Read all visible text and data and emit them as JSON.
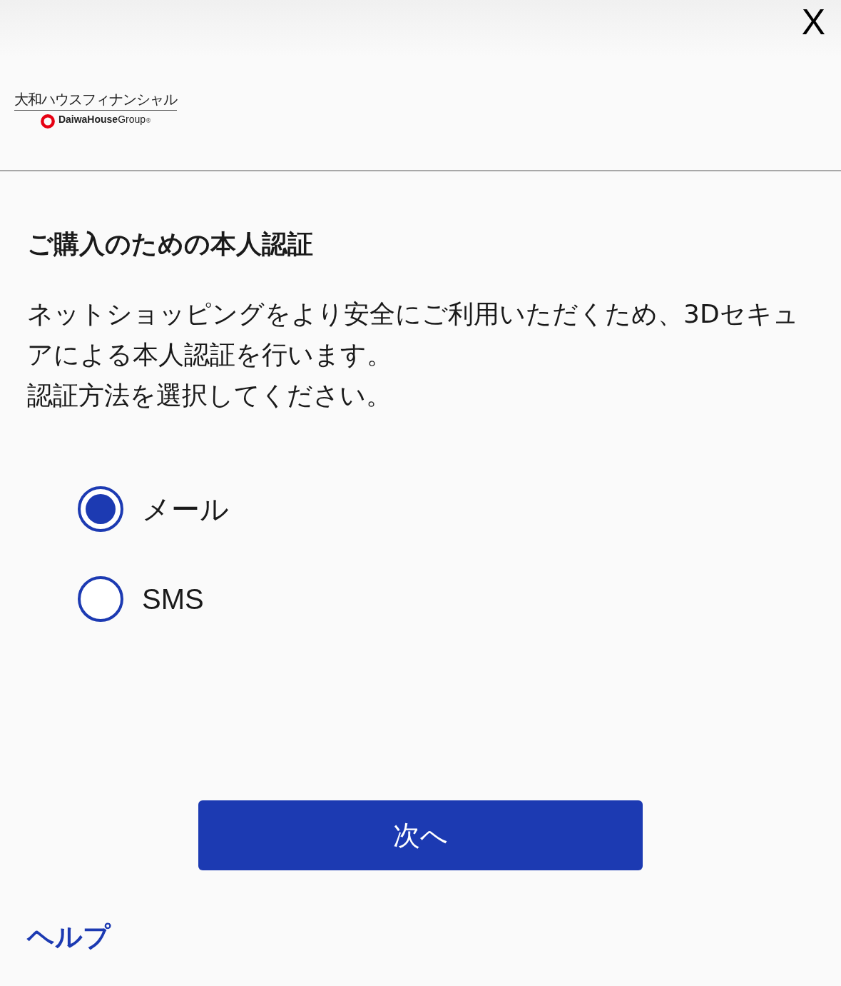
{
  "header": {
    "close": "X",
    "logo": {
      "name": "大和ハウスフィナンシャル",
      "brand": "DaiwaHouse",
      "group": "Group",
      "mark": "®"
    }
  },
  "title": "ご購入のための本人認証",
  "paragraphs": [
    "ネットショッピングをより安全にご利用いただくため、3Dセキュアによる本人認証を行います。",
    "認証方法を選択してください。"
  ],
  "options": [
    {
      "label": "メール",
      "selected": true
    },
    {
      "label": "SMS",
      "selected": false
    }
  ],
  "button": "次へ",
  "help_link": "ヘルプ"
}
